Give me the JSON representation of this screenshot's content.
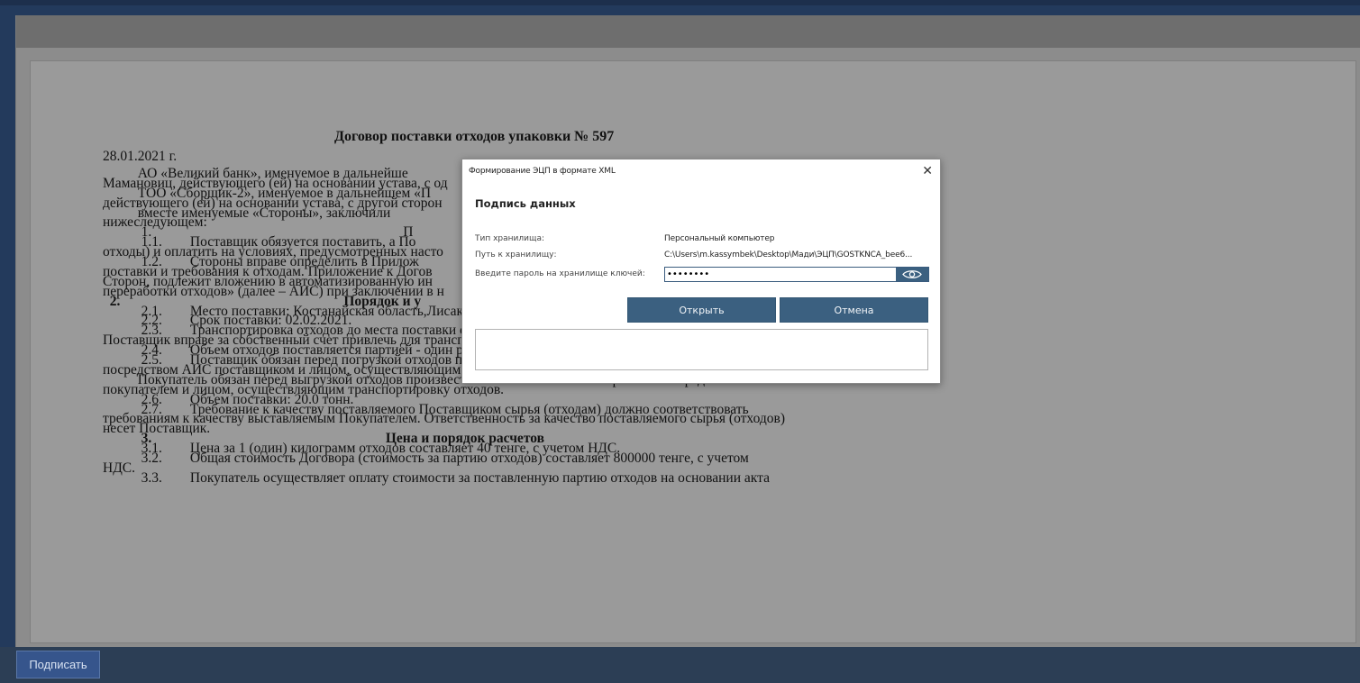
{
  "document": {
    "title": "Договор поставки отходов упаковки № 597",
    "lines": [
      {
        "text": "28.01.2021 г.",
        "bold": false
      },
      {
        "text": "          АО «Великий банк», именуемое в дальнейше",
        "bold": false
      },
      {
        "text": "Мамановиц, действующего (ей) на основании устава, с од",
        "bold": false
      },
      {
        "text": "          ТОО «Сборщик-2», именуемое в дальнейшем «П",
        "bold": false
      },
      {
        "text": "действующего (ей) на основании устава, с другой сторон",
        "bold": false
      },
      {
        "text": "          вместе именуемые «Стороны», заключили",
        "bold": false
      },
      {
        "text": "нижеследующем:",
        "bold": false
      },
      {
        "text": "           1.                                                                        П",
        "bold": false
      },
      {
        "text": "           1.1.        Поставщик обязуется поставить, а По",
        "bold": false
      },
      {
        "text": "отходы) и оплатить на условиях, предусмотренных насто",
        "bold": false
      },
      {
        "text": "           1.2.        Стороны вправе определить в Прилож",
        "bold": false
      },
      {
        "text": "поставки и требования к отходам. Приложение к Догов",
        "bold": false
      },
      {
        "text": "Сторон, подлежит вложению в автоматизированную ин",
        "bold": false
      },
      {
        "text": "переработки отходов» (далее – АИС) при заключении в н",
        "bold": false
      },
      {
        "text": "  2.                                                                Порядок и у",
        "bold": true
      },
      {
        "text": "           2.1.        Место поставки: Костанайская область,Лисаковск Г.А.д.Лисаковск, Пушкина, 23, 33.",
        "bold": false
      },
      {
        "text": "           2.2.        Срок поставки: 02.02.2021.",
        "bold": false
      },
      {
        "text": "           2.3.        Транспортировка отходов до места поставки осуществляется силами и за счет Поставщика.",
        "bold": false
      },
      {
        "text": "Поставщик вправе за собственный счет привлечь для транспортировки отходов третьих лиц.",
        "bold": false
      },
      {
        "text": "           2.4.        Объем отходов поставляется партией - один рейс на единицу транспортного средства.",
        "bold": false
      },
      {
        "text": "           2.5.        Поставщик обязан перед погрузкой отходов произвести их взвешивание и актирование",
        "bold": false
      },
      {
        "text": "посредством АИС поставщиком и лицом, осуществляющим транспортировку отходов.",
        "bold": false
      },
      {
        "text": "          Покупатель обязан перед выгрузкой отходов произвести их взвешивание и актирование посредством АИС",
        "bold": false
      },
      {
        "text": "покупателем и лицом, осуществляющим транспортировку отходов.",
        "bold": false
      },
      {
        "text": "           2.6.        Объем поставки: 20.0 тонн.",
        "bold": false
      },
      {
        "text": "           2.7.        Требование к качеству поставляемого Поставщиком сырья (отходам) должно соответствовать",
        "bold": false
      },
      {
        "text": "требованиям к качеству выставляемым Покупателем. Ответственность за качество поставляемого сырья (отходов)",
        "bold": false
      },
      {
        "text": "несет Поставщик.",
        "bold": false
      },
      {
        "text": "           3.                                                                   Цена и порядок расчетов",
        "bold": true
      },
      {
        "text": "           3.1.        Цена за 1 (один) килограмм отходов составляет 40 тенге, с учетом НДС.",
        "bold": false
      },
      {
        "text": "           3.2.        Общая стоимость Договора (стоимость за партию отходов) составляет 800000 тенге, с учетом",
        "bold": false
      },
      {
        "text": "НДС.",
        "bold": false
      },
      {
        "text": "           3.3.        Покупатель осуществляет оплату стоимости за поставленную партию отходов на основании акта",
        "bold": false
      }
    ]
  },
  "dialog": {
    "title": "Формирование ЭЦП в формате XML",
    "close_glyph": "✕",
    "heading": "Подпись данных",
    "storage_type_label": "Тип хранилища:",
    "storage_type_value": "Персональный компьютер",
    "storage_path_label": "Путь к хранилищу:",
    "storage_path_value": "C:\\Users\\m.kassymbek\\Desktop\\Мади\\ЭЦП\\GOSTKNCA_bee6...",
    "password_label": "Введите пароль на хранилище ключей:",
    "password_value": "••••••••",
    "open_button": "Открыть",
    "cancel_button": "Отмена"
  },
  "footer": {
    "sign_button": "Подписать"
  },
  "colors": {
    "accent": "#3b6080",
    "sign_button": "#36558c"
  }
}
